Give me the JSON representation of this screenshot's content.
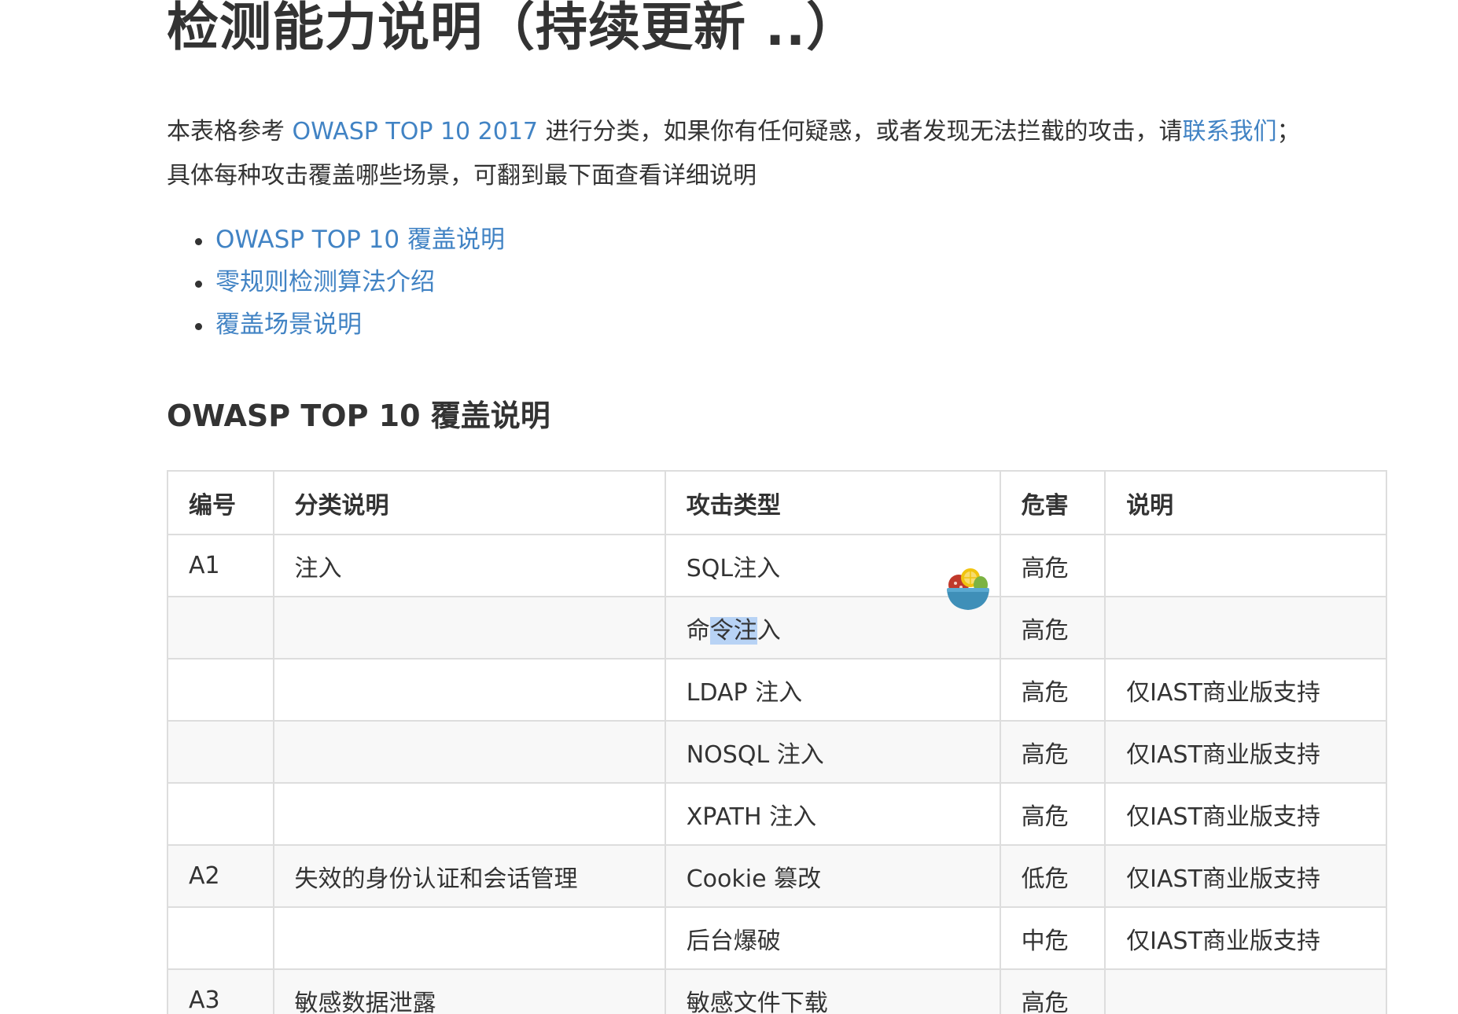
{
  "page": {
    "title": "检测能力说明（持续更新 ..）"
  },
  "intro": {
    "line1_before": "本表格参考 ",
    "owasp_link": "OWASP TOP 10 2017",
    "line1_middle": " 进行分类，如果你有任何疑惑，或者发现无法拦截的攻击，请",
    "contact_link": "联系我们",
    "line1_after": "；",
    "line2": "具体每种攻击覆盖哪些场景，可翻到最下面查看详细说明"
  },
  "toc": {
    "items": [
      {
        "label": "OWASP TOP 10 覆盖说明"
      },
      {
        "label": "零规则检测算法介绍"
      },
      {
        "label": "覆盖场景说明"
      }
    ]
  },
  "section": {
    "title": "OWASP TOP 10 覆盖说明"
  },
  "table": {
    "headers": {
      "id": "编号",
      "category": "分类说明",
      "attack_type": "攻击类型",
      "risk": "危害",
      "note": "说明"
    },
    "rows": [
      {
        "id": "A1",
        "category": "注入",
        "attack_type": "SQL注入",
        "risk": "高危",
        "note": ""
      },
      {
        "id": "",
        "category": "",
        "attack_type_pre": "命",
        "attack_type_sel": "令注",
        "attack_type_post": "入",
        "risk": "高危",
        "note": ""
      },
      {
        "id": "",
        "category": "",
        "attack_type": "LDAP 注入",
        "risk": "高危",
        "note": "仅IAST商业版支持"
      },
      {
        "id": "",
        "category": "",
        "attack_type": "NOSQL 注入",
        "risk": "高危",
        "note": "仅IAST商业版支持"
      },
      {
        "id": "",
        "category": "",
        "attack_type": "XPATH 注入",
        "risk": "高危",
        "note": "仅IAST商业版支持"
      },
      {
        "id": "A2",
        "category": "失效的身份认证和会话管理",
        "attack_type": "Cookie 篡改",
        "risk": "低危",
        "note": "仅IAST商业版支持"
      },
      {
        "id": "",
        "category": "",
        "attack_type": "后台爆破",
        "risk": "中危",
        "note": "仅IAST商业版支持"
      },
      {
        "id": "A3",
        "category": "敏感数据泄露",
        "attack_type": "敏感文件下载",
        "risk": "高危",
        "note": ""
      }
    ]
  },
  "colors": {
    "text": "#333333",
    "link": "#4183c4",
    "border": "#dddddd",
    "row_alt": "#f8f8f8",
    "selection": "#b8d3f5"
  },
  "cursor": {
    "icon": "salad-bowl-cursor-icon"
  }
}
